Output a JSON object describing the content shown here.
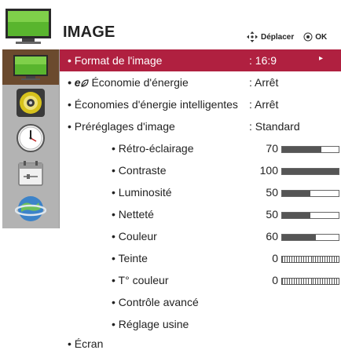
{
  "header": {
    "title": "IMAGE",
    "nav_label": "Déplacer",
    "ok_label": "OK",
    "nav_icon": "dpad-arrows-icon",
    "ok_icon": "ok-button-icon"
  },
  "sidebar": {
    "items": [
      {
        "icon": "tv-picture-icon",
        "selected": true
      },
      {
        "icon": "speaker-icon",
        "selected": false
      },
      {
        "icon": "clock-icon",
        "selected": false
      },
      {
        "icon": "calendar-options-icon",
        "selected": false
      },
      {
        "icon": "network-globe-icon",
        "selected": false
      }
    ]
  },
  "menu": {
    "items": [
      {
        "label": "• Format de l'image",
        "value": ": 16:9",
        "arrow": "▸"
      },
      {
        "label": "Économie d'énergie",
        "prefix": "• e",
        "value": ": Arrêt"
      },
      {
        "label": "• Économies d'énergie intelligentes",
        "value": ": Arrêt"
      },
      {
        "label": "• Préréglages d'image",
        "value": ": Standard"
      }
    ],
    "sub_items": [
      {
        "label": "• Rétro-éclairage",
        "value": "70",
        "level": 0.7
      },
      {
        "label": "• Contraste",
        "value": "100",
        "level": 1.0
      },
      {
        "label": "• Luminosité",
        "value": "50",
        "level": 0.5
      },
      {
        "label": "• Netteté",
        "value": "50",
        "level": 0.5
      },
      {
        "label": "• Couleur",
        "value": "60",
        "level": 0.6
      },
      {
        "label": "• Teinte",
        "value": "0",
        "type": "center"
      },
      {
        "label": "• T° couleur",
        "value": "0",
        "type": "center"
      },
      {
        "label": "• Contrôle avancé"
      },
      {
        "label": "• Réglage usine"
      }
    ],
    "footer_item": "• Écran"
  },
  "colors": {
    "selection": "#b02040",
    "sidebar_bg": "#b3b3b3",
    "sidebar_selected": "#6b4a2e"
  }
}
